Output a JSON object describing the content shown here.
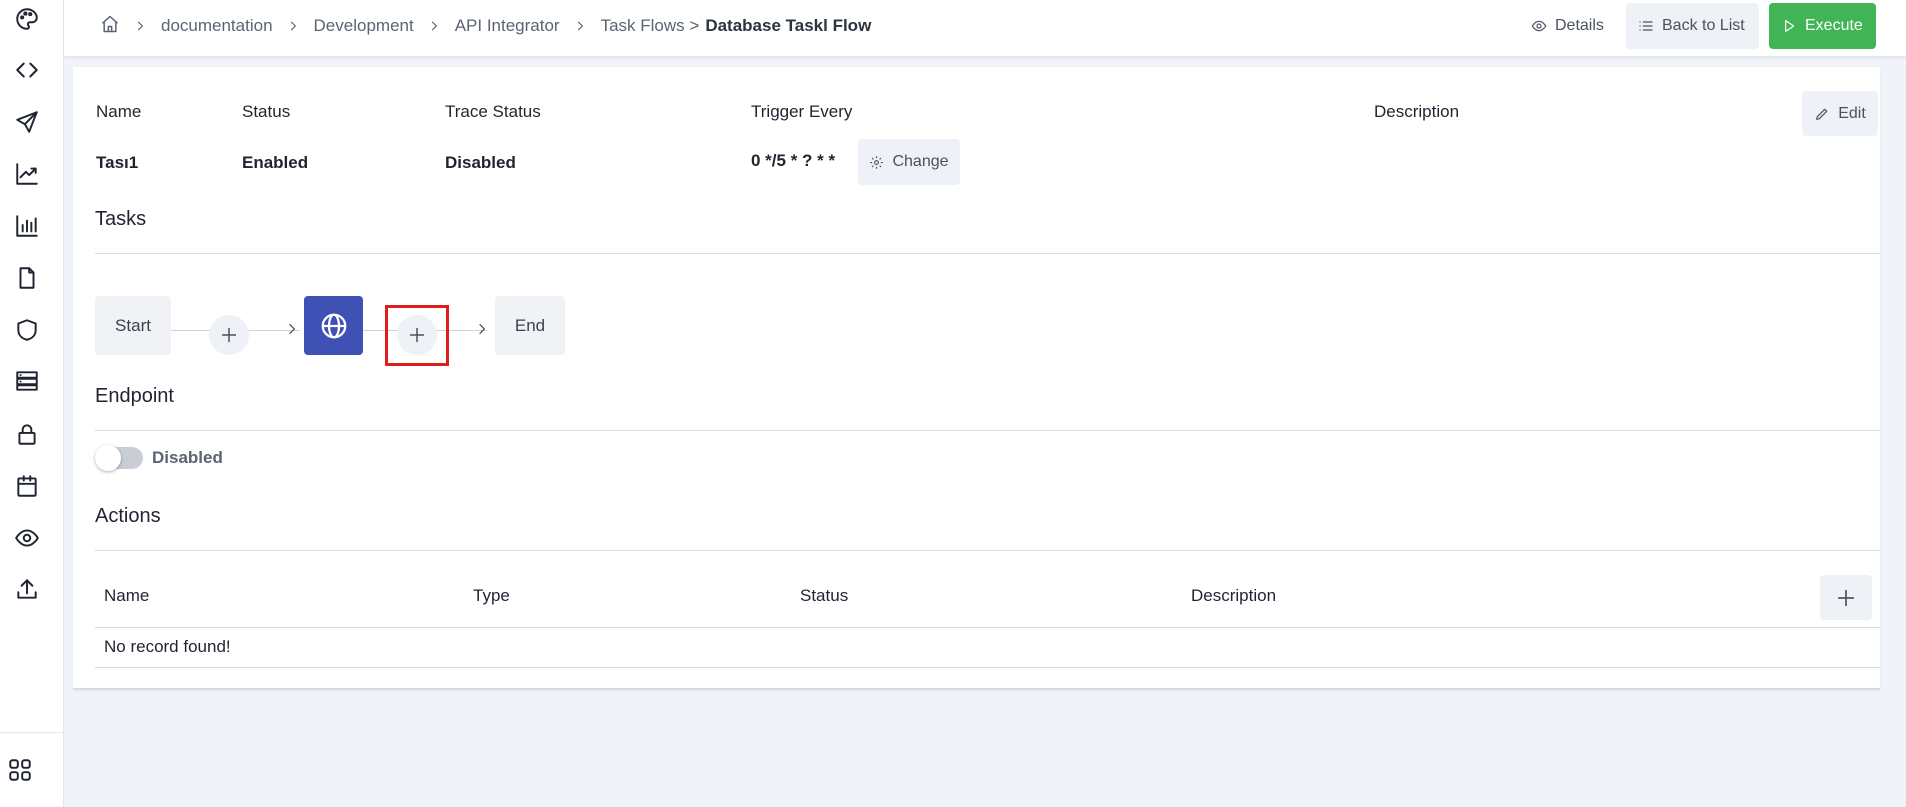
{
  "sidebar": {
    "icons": [
      "palette-icon",
      "code-icon",
      "send-icon",
      "line-chart-icon",
      "bar-chart-icon",
      "file-icon",
      "shield-icon",
      "server-icon",
      "lock-icon",
      "calendar-icon",
      "eye-icon",
      "upload-icon",
      "apps-grid-icon"
    ]
  },
  "breadcrumb": {
    "items": [
      "documentation",
      "Development",
      "API Integrator",
      "Task Flows >"
    ],
    "current": "Database Taskl Flow"
  },
  "toolbar": {
    "details_label": "Details",
    "back_label": "Back to List",
    "execute_label": "Execute"
  },
  "info": {
    "name_label": "Name",
    "name_value": "Tası1",
    "status_label": "Status",
    "status_value": "Enabled",
    "trace_label": "Trace Status",
    "trace_value": "Disabled",
    "trigger_label": "Trigger Every",
    "trigger_value": "0 */5 * ? * *",
    "change_label": "Change",
    "description_label": "Description",
    "edit_label": "Edit"
  },
  "tasks": {
    "title": "Tasks",
    "start_label": "Start",
    "end_label": "End"
  },
  "endpoint": {
    "title": "Endpoint",
    "toggle_label": "Disabled"
  },
  "actions": {
    "title": "Actions",
    "columns": [
      "Name",
      "Type",
      "Status",
      "Description"
    ],
    "empty_message": "No record found!"
  },
  "colors": {
    "accent": "#3f51b5",
    "execute": "#41b556",
    "highlight": "#e01d1d"
  }
}
